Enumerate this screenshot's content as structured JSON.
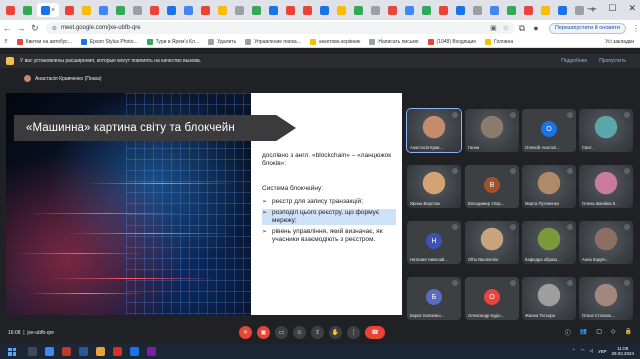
{
  "browser": {
    "url": "meet.google.com/jxe-ubfb-qre",
    "translate_label": "Перезапустити й оновити",
    "bookmarks": [
      {
        "label": "Квитки на автобус...",
        "color": "#e8453c"
      },
      {
        "label": "Epson Stylus Photo...",
        "color": "#1a73e8"
      },
      {
        "label": "Тури в Ярем'з Кл...",
        "color": "#34a853"
      },
      {
        "label": "Удалить",
        "color": "#9aa0a6"
      },
      {
        "label": "Управление папка...",
        "color": "#9aa0a6"
      },
      {
        "label": "анкетова керівник",
        "color": "#fbbc04"
      },
      {
        "label": "Написать письмо",
        "color": "#9aa0a6"
      },
      {
        "label": "(1048) Входящие",
        "color": "#ea4335"
      },
      {
        "label": "Головна",
        "color": "#fbbc04"
      }
    ],
    "all_bookmarks_label": "Усі закладки"
  },
  "banner": {
    "text": "У вас установлены расширения, которые могут повлиять на качество вызова.",
    "details_label": "Подробнее",
    "dismiss_label": "Пропустить"
  },
  "presenter": {
    "label": "Анастасія Кравченко (Показ)"
  },
  "slide": {
    "title": "«Машинна» картина світу та блокчейн",
    "intro": "дослівно з англ. «blockchain» – «ланцюжок блоків»:",
    "heading": "Система блокчейну:",
    "bullets": [
      "реєстр для запису транзакцій;",
      "розподіл цього реєстру, що формує мережу;",
      "рівень управління, який визначає, як учасники взаємодіють з реєстром."
    ]
  },
  "participants": [
    {
      "name": "Анастасія Крав...",
      "initial": "",
      "color": "#c48b6c",
      "photo": true,
      "speaking": true
    },
    {
      "name": "Ганна",
      "initial": "",
      "color": "#8c7b6a",
      "photo": true,
      "speaking": false
    },
    {
      "name": "Олексій Анатолі...",
      "initial": "О",
      "color": "#1a73e8",
      "photo": false,
      "speaking": false
    },
    {
      "name": "Свит...",
      "initial": "",
      "color": "#5aa6a8",
      "photo": true,
      "speaking": false
    },
    {
      "name": "Ирина Верстюк",
      "initial": "",
      "color": "#d4a373",
      "photo": true,
      "speaking": false
    },
    {
      "name": "Володимир Упор...",
      "initial": "В",
      "color": "#a0522d",
      "photo": false,
      "speaking": false
    },
    {
      "name": "Марта Путаненко",
      "initial": "",
      "color": "#b08968",
      "photo": true,
      "speaking": false
    },
    {
      "name": "Олена Іванівна К...",
      "initial": "",
      "color": "#c97b9b",
      "photo": true,
      "speaking": false
    },
    {
      "name": "Наталия Николай...",
      "initial": "Н",
      "color": "#3f51b5",
      "photo": false,
      "speaking": false
    },
    {
      "name": "Olha Naumenko",
      "initial": "",
      "color": "#c9a27e",
      "photo": true,
      "speaking": false
    },
    {
      "name": "Кафедра образо...",
      "initial": "",
      "color": "#7a9a3a",
      "photo": true,
      "speaking": false
    },
    {
      "name": "Анна Каруїн...",
      "initial": "",
      "color": "#8d6e63",
      "photo": true,
      "speaking": false
    },
    {
      "name": "Борис Калиниш...",
      "initial": "Б",
      "color": "#5c6bc0",
      "photo": false,
      "speaking": false
    },
    {
      "name": "Олександр Кудін...",
      "initial": "О",
      "color": "#e8453c",
      "photo": false,
      "speaking": false
    },
    {
      "name": "Жанна Тетьора",
      "initial": "",
      "color": "#9e9e9e",
      "photo": true,
      "speaking": false
    },
    {
      "name": "Ольга Степано...",
      "initial": "",
      "color": "#a1887f",
      "photo": true,
      "speaking": false
    }
  ],
  "controls": {
    "time": "16:08",
    "meeting_code": "jxe-ubfb-qre"
  },
  "taskbar": {
    "language": "УКР",
    "time": "11:08",
    "date": "29.03.2024"
  }
}
